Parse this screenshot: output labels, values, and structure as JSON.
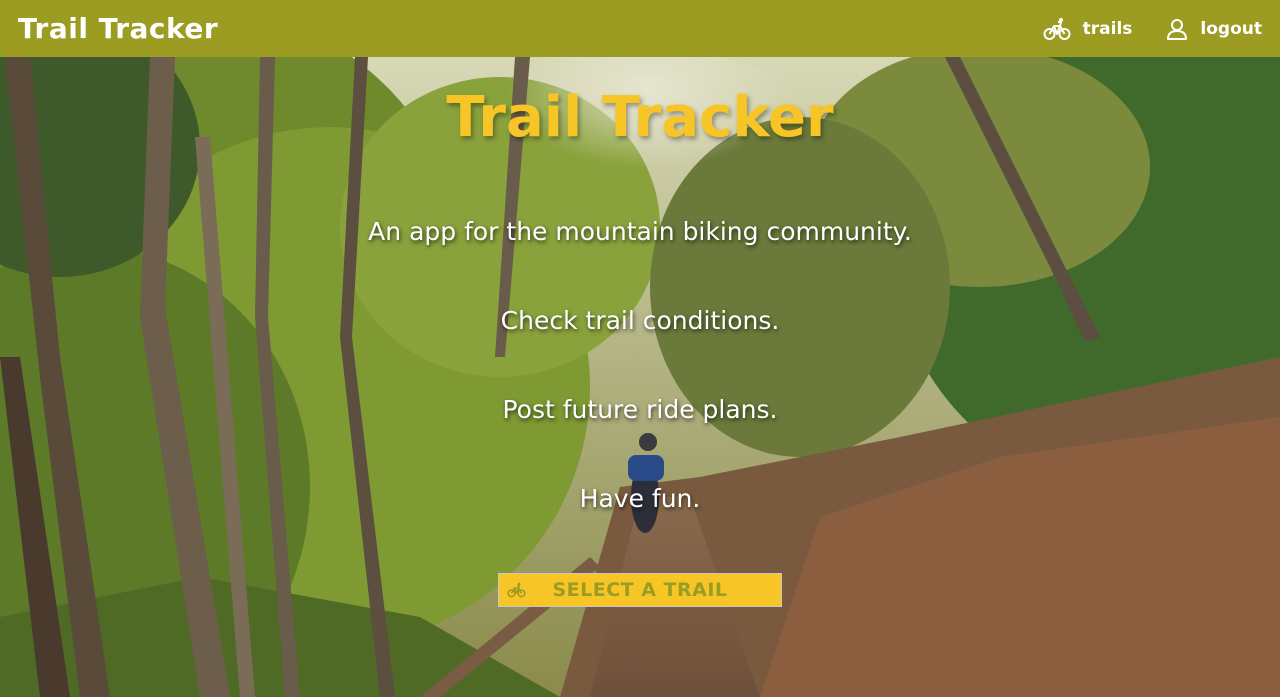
{
  "app": {
    "brand": "Trail Tracker"
  },
  "nav": {
    "items": [
      {
        "label": "trails",
        "icon": "bicycle-icon"
      },
      {
        "label": "logout",
        "icon": "user-icon"
      }
    ]
  },
  "hero": {
    "title": "Trail Tracker",
    "taglines": [
      "An app for the mountain biking community.",
      "Check trail conditions.",
      "Post future ride plans.",
      "Have fun."
    ],
    "cta_label": "SELECT A TRAIL",
    "cta_icon": "bicycle-icon"
  },
  "colors": {
    "navbar": "#9c9c22",
    "accent": "#f7c526",
    "text": "#ffffff"
  }
}
